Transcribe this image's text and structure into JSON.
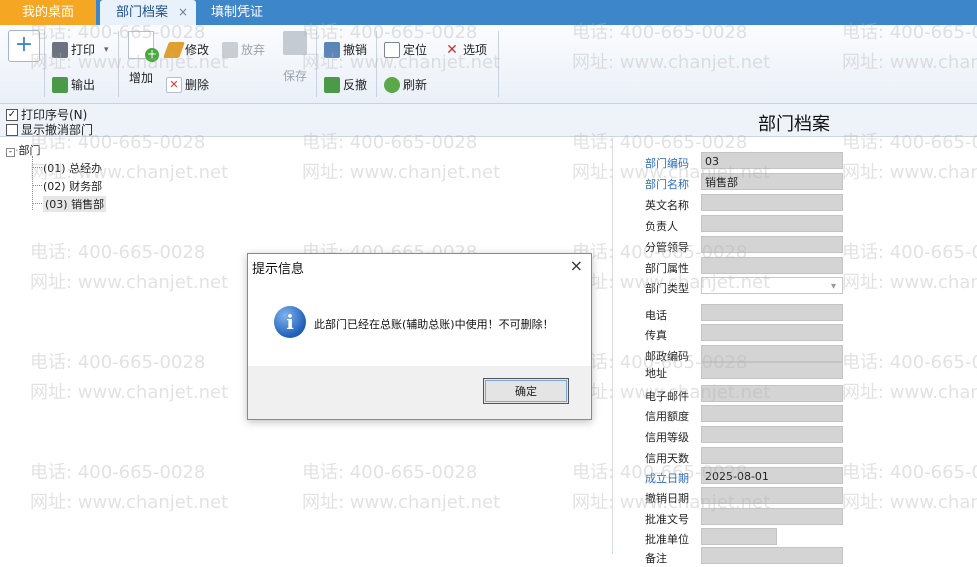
{
  "tabs": {
    "home": "我的桌面",
    "active": "部门档案",
    "active_close": "×",
    "voucher": "填制凭证"
  },
  "toolbar": {
    "plus": "+",
    "print": "打印",
    "export": "输出",
    "add": "增加",
    "edit": "修改",
    "discard": "放弃",
    "delete": "删除",
    "save": "保存",
    "undo": "撤销",
    "reverse": "反撤",
    "locate": "定位",
    "refresh": "刷新",
    "options": "选项"
  },
  "options": {
    "print_seq": "打印序号(N)",
    "show_cancelled": "显示撤消部门",
    "form_title": "部门档案"
  },
  "tree": {
    "root": "部门",
    "items": [
      "(01) 总经办",
      "(02) 财务部",
      "(03) 销售部"
    ]
  },
  "form": {
    "fields": [
      {
        "label": "部门编码",
        "value": "03",
        "required": true
      },
      {
        "label": "部门名称",
        "value": "销售部",
        "required": true
      },
      {
        "label": "英文名称",
        "value": "",
        "required": false
      },
      {
        "label": "负责人",
        "value": "",
        "required": false
      },
      {
        "label": "分管领导",
        "value": "",
        "required": false
      },
      {
        "label": "部门属性",
        "value": "",
        "required": false
      },
      {
        "label": "部门类型",
        "value": "",
        "required": false
      },
      {
        "label": "电话",
        "value": "",
        "required": false
      },
      {
        "label": "传真",
        "value": "",
        "required": false
      },
      {
        "label": "邮政编码",
        "value": "",
        "required": false
      },
      {
        "label": "地址",
        "value": "",
        "required": false
      },
      {
        "label": "电子邮件",
        "value": "",
        "required": false
      },
      {
        "label": "信用额度",
        "value": "",
        "required": false
      },
      {
        "label": "信用等级",
        "value": "",
        "required": false
      },
      {
        "label": "信用天数",
        "value": "",
        "required": false
      },
      {
        "label": "成立日期",
        "value": "2025-08-01",
        "required": true
      },
      {
        "label": "撤销日期",
        "value": "",
        "required": false
      },
      {
        "label": "批准文号",
        "value": "",
        "required": false
      },
      {
        "label": "批准单位",
        "value": "",
        "required": false
      },
      {
        "label": "备注",
        "value": "",
        "required": false
      }
    ]
  },
  "dialog": {
    "title": "提示信息",
    "close": "×",
    "icon": "i",
    "message": "此部门已经在总账(辅助总账)中使用！不可删除！",
    "ok": "确定"
  },
  "watermark": {
    "phone": "电话: 400-665-0028",
    "site": "网址: www.chanjet.net"
  }
}
